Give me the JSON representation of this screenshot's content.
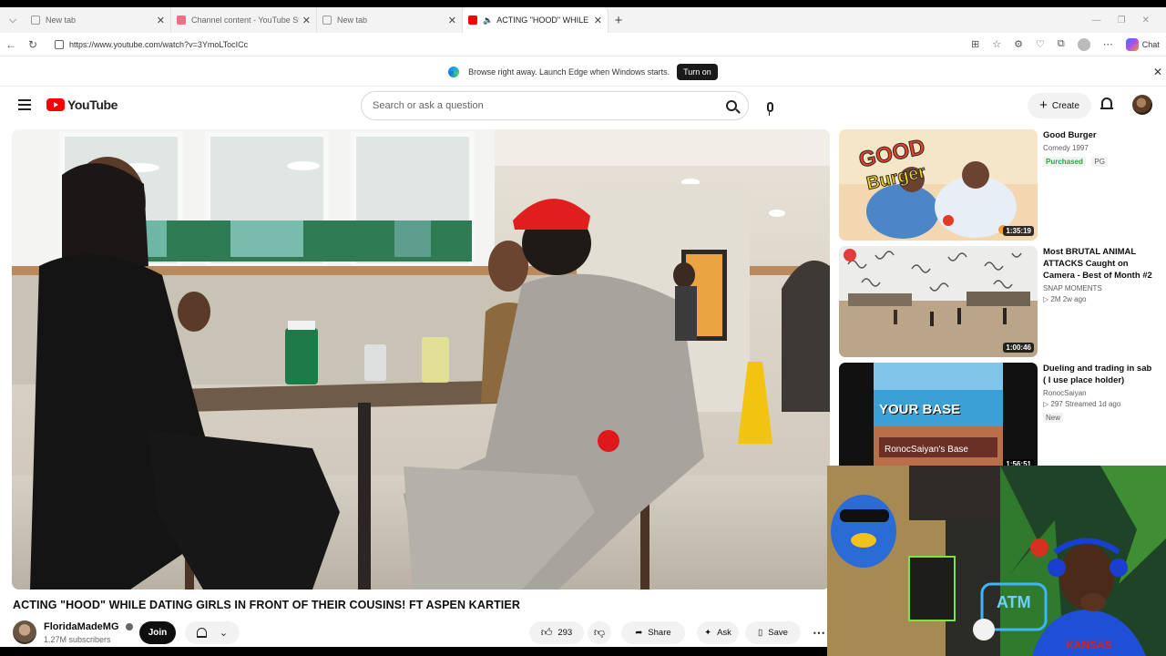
{
  "browser": {
    "tabs": [
      {
        "title": "New tab",
        "favicon": "blank-icon",
        "active": false
      },
      {
        "title": "Channel content - YouTube Studio",
        "favicon": "youtube-studio-icon",
        "active": false
      },
      {
        "title": "New tab",
        "favicon": "blank-icon",
        "active": false
      },
      {
        "title": "ACTING \"HOOD\" WHILE DATI",
        "favicon": "youtube-icon",
        "active": true,
        "audio": true
      }
    ],
    "url": "https://www.youtube.com/watch?v=3YmoLTocICc",
    "chat_label": "Chat"
  },
  "notification": {
    "text": "Browse right away. Launch Edge when Windows starts.",
    "button": "Turn on"
  },
  "youtube": {
    "logo_text": "YouTube",
    "search_placeholder": "Search or ask a question",
    "create_label": "Create"
  },
  "video": {
    "title": "ACTING \"HOOD\" WHILE DATING GIRLS IN FRONT OF THEIR COUSINS! FT ASPEN KARTIER",
    "channel": "FloridaMadeMG",
    "subscribers": "1.27M subscribers",
    "join_label": "Join",
    "likes": "293",
    "share_label": "Share",
    "ask_label": "Ask",
    "save_label": "Save"
  },
  "recommendations": [
    {
      "title": "Good Burger",
      "channel": "Comedy 1997",
      "badges": [
        "Purchased",
        "PG"
      ],
      "duration": "1:35:19",
      "stats": ""
    },
    {
      "title": "Most BRUTAL ANIMAL ATTACKS Caught on Camera - Best of Month #2",
      "channel": "SNAP MOMENTS",
      "stats": "▷ 2M  2w ago",
      "duration": "1:00:46"
    },
    {
      "title": "Dueling and trading in sab ( I use place holder)",
      "channel": "RonocSaiyan",
      "stats": "▷ 297  Streamed 1d ago",
      "badge": "New",
      "duration": "1:56:51",
      "thumb_text_1": "YOUR BASE",
      "thumb_text_2": "RonocSaiyan's Base"
    }
  ],
  "webcam": {
    "sign_text": "ATM",
    "shirt_text": "KANSAS"
  },
  "colors": {
    "youtube_red": "#ff0000",
    "purchased_green": "#2ba640"
  }
}
